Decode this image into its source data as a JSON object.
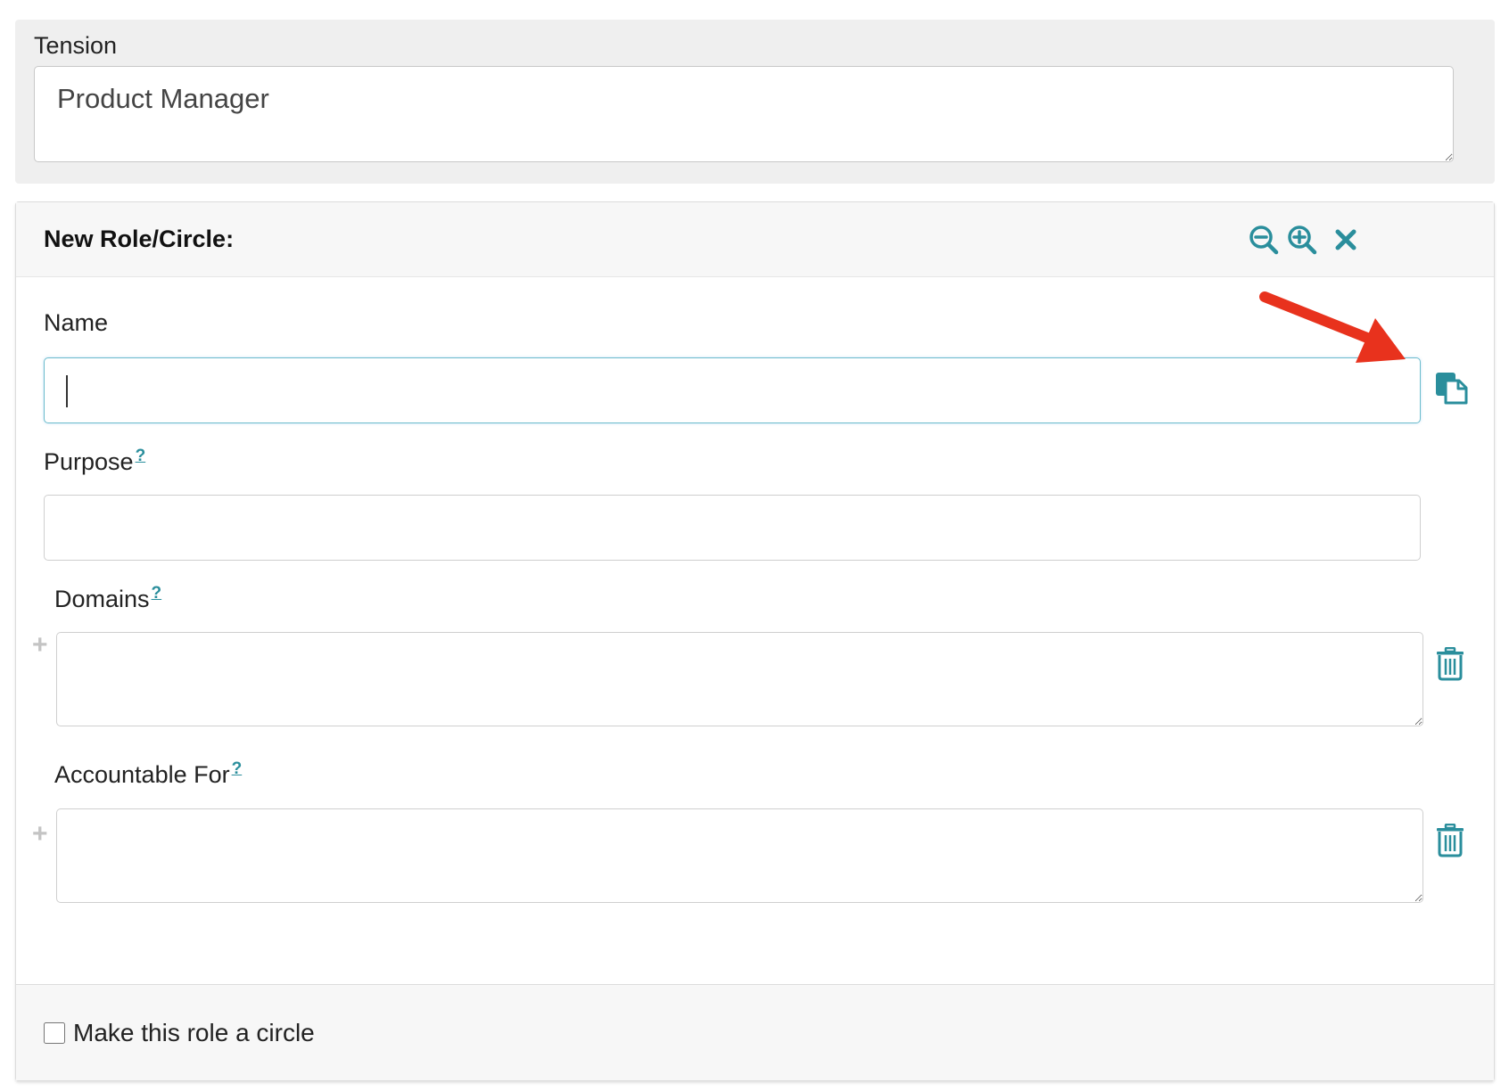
{
  "tension": {
    "label": "Tension",
    "value": "Product Manager"
  },
  "panel": {
    "title": "New Role/Circle:",
    "actions": {
      "zoom_out_icon": "zoom-out-icon",
      "zoom_in_icon": "zoom-in-icon",
      "close_icon": "close-icon"
    }
  },
  "form": {
    "name": {
      "label": "Name",
      "value": ""
    },
    "purpose": {
      "label": "Purpose",
      "help": "?",
      "value": ""
    },
    "domains": {
      "label": "Domains",
      "help": "?",
      "add_symbol": "+",
      "value": ""
    },
    "accountable_for": {
      "label": "Accountable For",
      "help": "?",
      "add_symbol": "+",
      "value": ""
    }
  },
  "footer": {
    "checkbox_label": "Make this role a circle",
    "checked": false
  },
  "colors": {
    "accent": "#2a8e9c",
    "focus_border": "#6cbccc",
    "annotation_arrow": "#e8321d",
    "panel_header_bg": "#f7f7f7",
    "tension_bg": "#efefef"
  }
}
